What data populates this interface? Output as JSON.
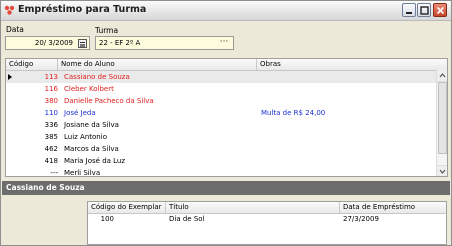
{
  "window": {
    "title": "Empréstimo para Turma"
  },
  "form": {
    "data_label": "Data",
    "data_value": "20/ 3/2009",
    "turma_label": "Turma",
    "turma_value": "22 - EF 2º A",
    "turma_button": "···"
  },
  "grid": {
    "columns": [
      "Código",
      "Nome do Aluno",
      "Obras"
    ],
    "rows": [
      {
        "code": "113",
        "name": "Cassiano de Souza",
        "obras": "",
        "color": "#e02020"
      },
      {
        "code": "116",
        "name": "Cleber Kolbert",
        "obras": "",
        "color": "#e02020"
      },
      {
        "code": "380",
        "name": "Danielle Pacheco da Silva",
        "obras": "",
        "color": "#e02020"
      },
      {
        "code": "110",
        "name": "José Jeda",
        "obras": "Multa de R$ 24,00",
        "color": "#1a2fd6"
      },
      {
        "code": "336",
        "name": "Josiane da Silva",
        "obras": "",
        "color": "#000000"
      },
      {
        "code": "385",
        "name": "Luiz Antonio",
        "obras": "",
        "color": "#000000"
      },
      {
        "code": "462",
        "name": "Marcos da Silva",
        "obras": "",
        "color": "#000000"
      },
      {
        "code": "418",
        "name": "Maria José da Luz",
        "obras": "",
        "color": "#000000"
      },
      {
        "code": "---",
        "name": "Merli Silva",
        "obras": "",
        "color": "#000000"
      }
    ]
  },
  "detail": {
    "student_name": "Cassiano de Souza",
    "columns": [
      "Código do Exemplar",
      "Título",
      "Data de Empréstimo"
    ],
    "rows": [
      {
        "code": "100",
        "title": "Dia de Sol",
        "date": "27/3/2009"
      }
    ]
  },
  "colors": {
    "overdue": "#e02020",
    "fine": "#1a2fd6",
    "detail_bar": "#6d6d6d"
  }
}
